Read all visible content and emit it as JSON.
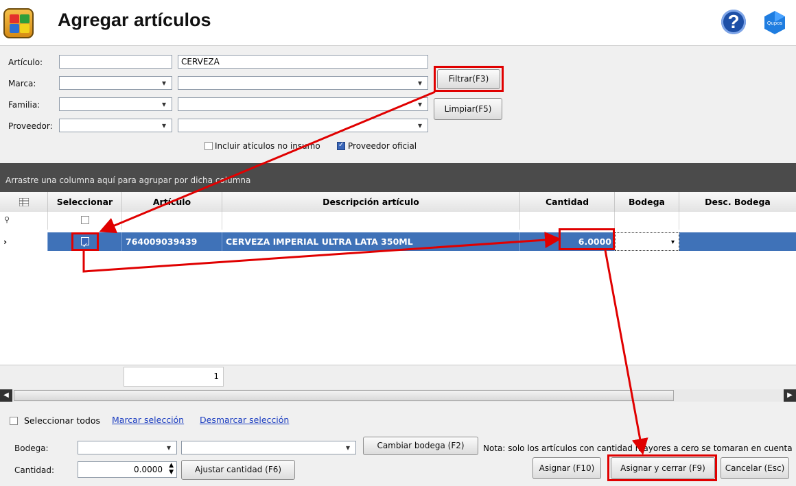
{
  "window": {
    "title": "Agregar artículos"
  },
  "filters": {
    "articulo_label": "Artículo:",
    "articulo_code": "",
    "articulo_text": "CERVEZA",
    "marca_label": "Marca:",
    "familia_label": "Familia:",
    "proveedor_label": "Proveedor:",
    "filtrar_button": "Filtrar(F3)",
    "limpiar_button": "Limpiar(F5)",
    "incluir_label": "Incluir atículos no insumo",
    "incluir_checked": false,
    "proveedor_oficial_label": "Proveedor oficial",
    "proveedor_oficial_checked": true
  },
  "grid": {
    "group_panel_text": "Arrastre una columna aquí para agrupar por dicha columna",
    "columns": [
      "Seleccionar",
      "Artículo",
      "Descripción artículo",
      "Cantidad",
      "Bodega",
      "Desc. Bodega"
    ],
    "rows": [
      {
        "selected": true,
        "articulo": "764009039439",
        "descripcion": "CERVEZA IMPERIAL ULTRA LATA 350ML",
        "cantidad": "6.0000",
        "bodega": "",
        "desc_bodega": ""
      }
    ],
    "row_count": "1"
  },
  "bottom": {
    "seleccionar_todos": "Seleccionar todos",
    "marcar": "Marcar selección",
    "desmarcar": "Desmarcar selección",
    "bodega_label": "Bodega:",
    "cambiar_bodega": "Cambiar bodega (F2)",
    "nota": "Nota: solo los artículos con cantidad mayores a cero se tomaran en cuenta",
    "cantidad_label": "Cantidad:",
    "cantidad_value": "0.0000",
    "ajustar_cantidad": "Ajustar cantidad (F6)",
    "asignar": "Asignar (F10)",
    "asignar_cerrar": "Asignar y cerrar (F9)",
    "cancelar": "Cancelar (Esc)"
  },
  "colors": {
    "accent_red": "#e00000",
    "selected_row": "#3f72b8",
    "group_panel": "#4b4b4b"
  }
}
